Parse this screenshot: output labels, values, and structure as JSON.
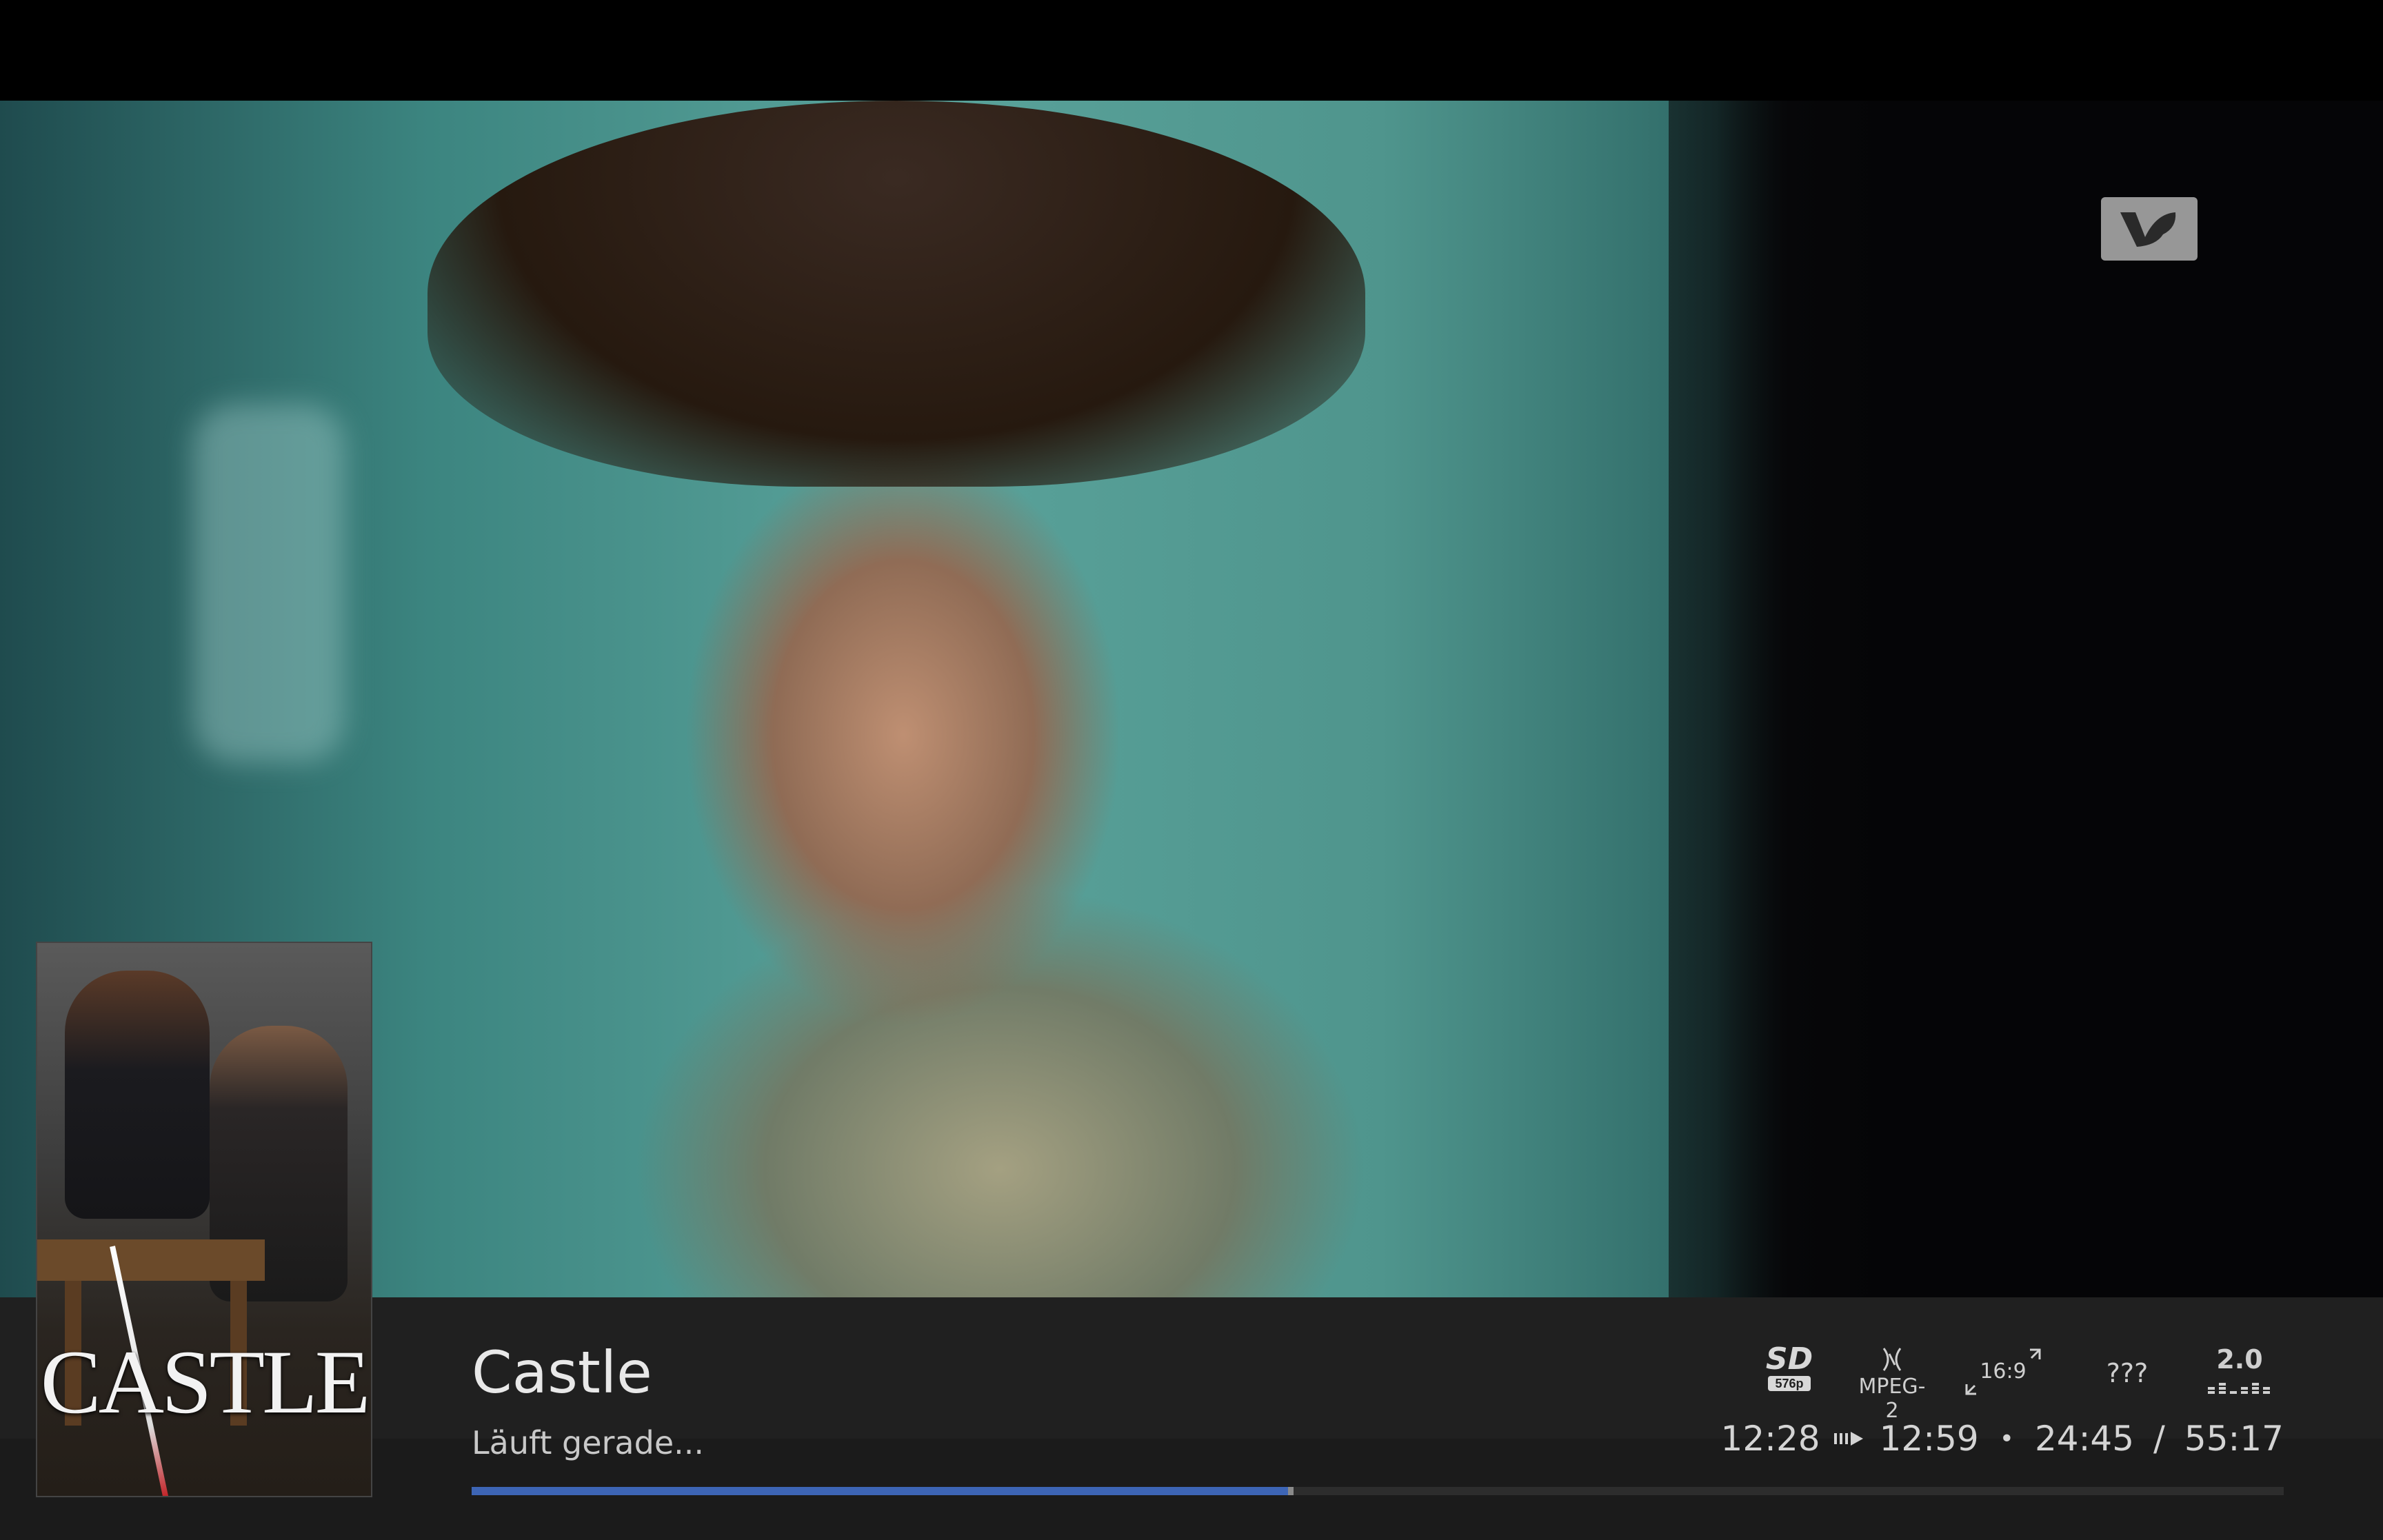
{
  "program": {
    "title": "Castle",
    "status": "Läuft gerade...",
    "poster_text": "CASTLE",
    "progress": 0.452
  },
  "info_icons": {
    "resolution": "SD",
    "resolution_sub": "576p",
    "codec": "MPEG-2",
    "aspect": "16:9",
    "language": "???",
    "audio": "2.0"
  },
  "times": {
    "start": "12:28",
    "end": "12:59",
    "bullet": "•",
    "elapsed": "24:45",
    "slash": "/",
    "duration": "55:17"
  },
  "icons": {
    "channel": "kabel-eins-logo-icon",
    "arrow": "arrow-right-icon",
    "codec": "broadcast-icon",
    "aspect": "aspect-ratio-icon",
    "audio": "audio-channels-icon"
  },
  "colors": {
    "bar_bg": "#202020",
    "progress": "#3d65b5",
    "text": "#e8e8e8"
  }
}
